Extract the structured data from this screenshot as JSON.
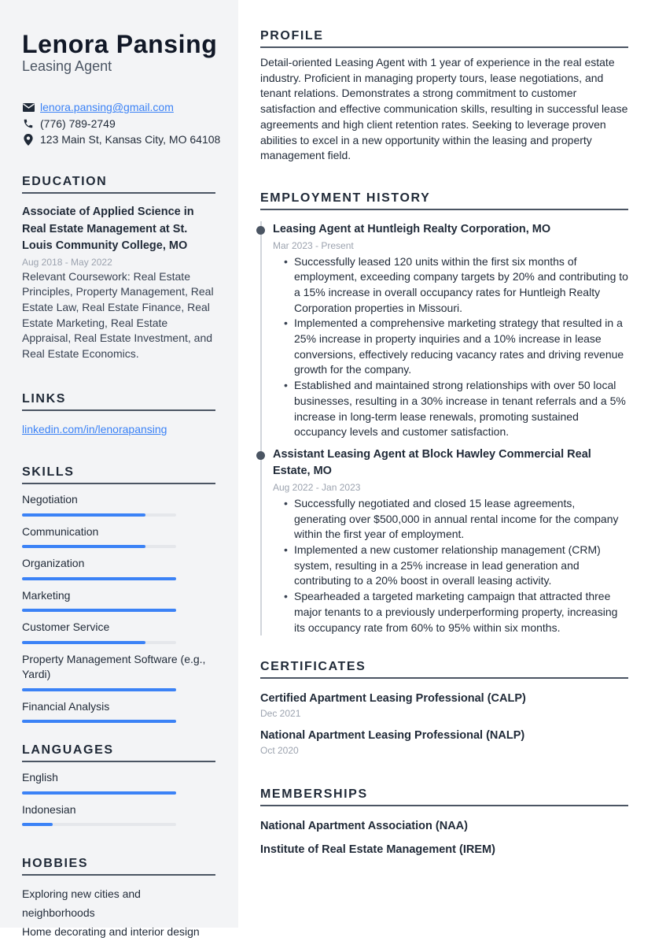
{
  "header": {
    "name": "Lenora Pansing",
    "title": "Leasing Agent"
  },
  "contact": {
    "email": "lenora.pansing@gmail.com",
    "phone": "(776) 789-2749",
    "address": "123 Main St, Kansas City, MO 64108",
    "icons": [
      "envelope-icon",
      "phone-icon",
      "map-pin-icon"
    ]
  },
  "education": {
    "heading": "EDUCATION",
    "degree": "Associate of Applied Science in Real Estate Management at St. Louis Community College, MO",
    "dates": "Aug 2018 - May 2022",
    "description": "Relevant Coursework: Real Estate Principles, Property Management, Real Estate Law, Real Estate Finance, Real Estate Marketing, Real Estate Appraisal, Real Estate Investment, and Real Estate Economics."
  },
  "links": {
    "heading": "LINKS",
    "items": [
      "linkedin.com/in/lenorapansing"
    ]
  },
  "skills": {
    "heading": "SKILLS",
    "items": [
      {
        "label": "Negotiation",
        "level": 0.8
      },
      {
        "label": "Communication",
        "level": 0.8
      },
      {
        "label": "Organization",
        "level": 1.0
      },
      {
        "label": "Marketing",
        "level": 1.0
      },
      {
        "label": "Customer Service",
        "level": 0.8
      },
      {
        "label": "Property Management Software (e.g., Yardi)",
        "level": 1.0
      },
      {
        "label": "Financial Analysis",
        "level": 1.0
      }
    ]
  },
  "languages": {
    "heading": "LANGUAGES",
    "items": [
      {
        "label": "English",
        "level": 1.0
      },
      {
        "label": "Indonesian",
        "level": 0.2
      }
    ]
  },
  "hobbies": {
    "heading": "HOBBIES",
    "items": [
      "Exploring new cities and neighborhoods",
      "Home decorating and interior design"
    ]
  },
  "profile": {
    "heading": "PROFILE",
    "text": "Detail-oriented Leasing Agent with 1 year of experience in the real estate industry. Proficient in managing property tours, lease negotiations, and tenant relations. Demonstrates a strong commitment to customer satisfaction and effective communication skills, resulting in successful lease agreements and high client retention rates. Seeking to leverage proven abilities to excel in a new opportunity within the leasing and property management field."
  },
  "employment": {
    "heading": "EMPLOYMENT HISTORY",
    "jobs": [
      {
        "title": "Leasing Agent at Huntleigh Realty Corporation, MO",
        "dates": "Mar 2023 - Present",
        "bullets": [
          "Successfully leased 120 units within the first six months of employment, exceeding company targets by 20% and contributing to a 15% increase in overall occupancy rates for Huntleigh Realty Corporation properties in Missouri.",
          "Implemented a comprehensive marketing strategy that resulted in a 25% increase in property inquiries and a 10% increase in lease conversions, effectively reducing vacancy rates and driving revenue growth for the company.",
          "Established and maintained strong relationships with over 50 local businesses, resulting in a 30% increase in tenant referrals and a 5% increase in long-term lease renewals, promoting sustained occupancy levels and customer satisfaction."
        ]
      },
      {
        "title": "Assistant Leasing Agent at Block Hawley Commercial Real Estate, MO",
        "dates": "Aug 2022 - Jan 2023",
        "bullets": [
          "Successfully negotiated and closed 15 lease agreements, generating over $500,000 in annual rental income for the company within the first year of employment.",
          "Implemented a new customer relationship management (CRM) system, resulting in a 25% increase in lead generation and contributing to a 20% boost in overall leasing activity.",
          "Spearheaded a targeted marketing campaign that attracted three major tenants to a previously underperforming property, increasing its occupancy rate from 60% to 95% within six months."
        ]
      }
    ]
  },
  "certificates": {
    "heading": "CERTIFICATES",
    "items": [
      {
        "title": "Certified Apartment Leasing Professional (CALP)",
        "date": "Dec 2021"
      },
      {
        "title": "National Apartment Leasing Professional (NALP)",
        "date": "Oct 2020"
      }
    ]
  },
  "memberships": {
    "heading": "MEMBERSHIPS",
    "items": [
      "National Apartment Association (NAA)",
      "Institute of Real Estate Management (IREM)"
    ]
  },
  "colors": {
    "accent": "#3b82f6",
    "sidebar_bg": "#f3f4f6",
    "heading_rule": "#4b5563",
    "muted": "#9ca3af"
  }
}
